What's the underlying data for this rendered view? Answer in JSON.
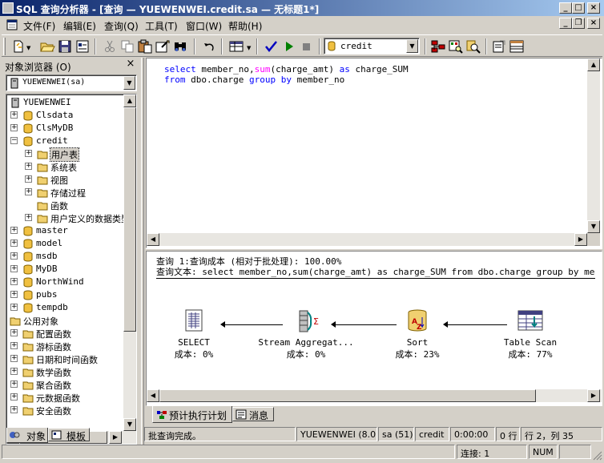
{
  "window": {
    "app_name": "SQL 查询分析器",
    "title_rest": " - [查询 — YUEWENWEI.credit.sa — 无标题1*]"
  },
  "menu": [
    "文件(F)",
    "编辑(E)",
    "查询(Q)",
    "工具(T)",
    "窗口(W)",
    "帮助(H)"
  ],
  "toolbar": {
    "database_value": "credit"
  },
  "object_browser": {
    "title": "对象浏览器 (O)",
    "server_combo": "YUEWENWEI(sa)",
    "tree": [
      {
        "label": "YUEWENWEI",
        "level": 0,
        "exp": "",
        "icon": "server"
      },
      {
        "label": "Clsdata",
        "level": 1,
        "exp": "+",
        "icon": "db"
      },
      {
        "label": "ClsMyDB",
        "level": 1,
        "exp": "+",
        "icon": "db"
      },
      {
        "label": "credit",
        "level": 1,
        "exp": "-",
        "icon": "db"
      },
      {
        "label": "用户表",
        "level": 2,
        "exp": "+",
        "icon": "folder",
        "selected": true
      },
      {
        "label": "系统表",
        "level": 2,
        "exp": "+",
        "icon": "folder"
      },
      {
        "label": "视图",
        "level": 2,
        "exp": "+",
        "icon": "folder"
      },
      {
        "label": "存储过程",
        "level": 2,
        "exp": "+",
        "icon": "folder"
      },
      {
        "label": "函数",
        "level": 2,
        "exp": "",
        "icon": "folder"
      },
      {
        "label": "用户定义的数据类型",
        "level": 2,
        "exp": "+",
        "icon": "folder"
      },
      {
        "label": "master",
        "level": 1,
        "exp": "+",
        "icon": "db"
      },
      {
        "label": "model",
        "level": 1,
        "exp": "+",
        "icon": "db"
      },
      {
        "label": "msdb",
        "level": 1,
        "exp": "+",
        "icon": "db"
      },
      {
        "label": "MyDB",
        "level": 1,
        "exp": "+",
        "icon": "db"
      },
      {
        "label": "NorthWind",
        "level": 1,
        "exp": "+",
        "icon": "db"
      },
      {
        "label": "pubs",
        "level": 1,
        "exp": "+",
        "icon": "db"
      },
      {
        "label": "tempdb",
        "level": 1,
        "exp": "+",
        "icon": "db"
      },
      {
        "label": "公用对象",
        "level": 0,
        "exp": "",
        "icon": "folder"
      },
      {
        "label": "配置函数",
        "level": 1,
        "exp": "+",
        "icon": "folder"
      },
      {
        "label": "游标函数",
        "level": 1,
        "exp": "+",
        "icon": "folder"
      },
      {
        "label": "日期和时间函数",
        "level": 1,
        "exp": "+",
        "icon": "folder"
      },
      {
        "label": "数学函数",
        "level": 1,
        "exp": "+",
        "icon": "folder"
      },
      {
        "label": "聚合函数",
        "level": 1,
        "exp": "+",
        "icon": "folder"
      },
      {
        "label": "元数据函数",
        "level": 1,
        "exp": "+",
        "icon": "folder"
      },
      {
        "label": "安全函数",
        "level": 1,
        "exp": "+",
        "icon": "folder"
      }
    ],
    "tabs": [
      "对象",
      "模板"
    ]
  },
  "editor": {
    "line1": {
      "kw1": "select",
      "t1": " member_no,",
      "fn": "sum",
      "t2": "(charge_amt) ",
      "kw2": "as",
      "t3": " charge_SUM"
    },
    "line2": {
      "kw1": "from",
      "t1": " dbo.charge ",
      "kw2": "group by",
      "t2": " member_no"
    }
  },
  "plan": {
    "header1": "查询 1:查询成本 (相对于批处理): 100.00%",
    "header2": "查询文本: select member_no,sum(charge_amt) as charge_SUM  from dbo.charge group by member_no",
    "nodes": [
      {
        "label": "SELECT",
        "cost": "成本: 0%"
      },
      {
        "label": "Stream Aggregat...",
        "cost": "成本: 0%"
      },
      {
        "label": "Sort",
        "cost": "成本: 23%"
      },
      {
        "label": "Table Scan",
        "cost": "成本: 77%"
      }
    ],
    "tabs": [
      "预计执行计划",
      "消息"
    ]
  },
  "status": {
    "message": "批查询完成。",
    "server": "YUEWENWEI (8.0)",
    "user": "sa (51)",
    "db": "credit",
    "time": "0:00:00",
    "rows": "0 行",
    "pos": "行 2，列 35",
    "connections": "连接: 1",
    "num": "NUM"
  }
}
